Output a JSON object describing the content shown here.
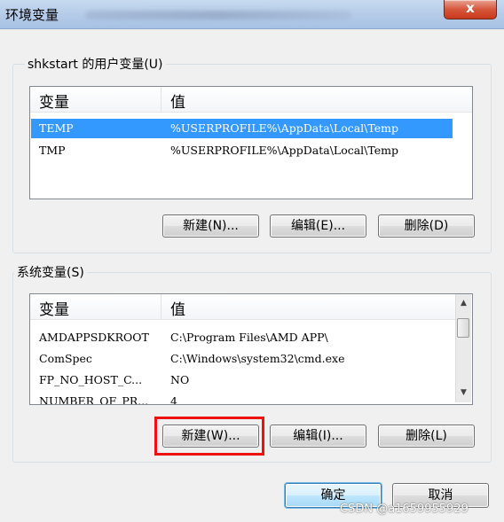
{
  "window": {
    "title": "环境变量",
    "close_label": "x"
  },
  "user_vars": {
    "group_label": "shkstart 的用户变量(U)",
    "columns": [
      "变量",
      "值"
    ],
    "rows": [
      {
        "name": "TEMP",
        "value": "%USERPROFILE%\\AppData\\Local\\Temp",
        "selected": true
      },
      {
        "name": "TMP",
        "value": "%USERPROFILE%\\AppData\\Local\\Temp",
        "selected": false
      }
    ],
    "buttons": {
      "new": "新建(N)...",
      "edit": "编辑(E)...",
      "delete": "删除(D)"
    }
  },
  "system_vars": {
    "group_label": "系统变量(S)",
    "columns": [
      "变量",
      "值"
    ],
    "rows": [
      {
        "name": "AMDAPPSDKROOT",
        "value": "C:\\Program Files\\AMD APP\\"
      },
      {
        "name": "ComSpec",
        "value": "C:\\Windows\\system32\\cmd.exe"
      },
      {
        "name": "FP_NO_HOST_C...",
        "value": "NO"
      },
      {
        "name": "NUMBER_OF_PR...",
        "value": "4"
      }
    ],
    "buttons": {
      "new": "新建(W)...",
      "edit": "编辑(I)...",
      "delete": "删除(L)"
    }
  },
  "footer": {
    "ok": "确定",
    "cancel": "取消"
  },
  "watermark": "CSDN @a1659955929",
  "colors": {
    "selection": "#3399ff",
    "highlight_box": "#e11111",
    "close_button": "#c8381c"
  }
}
